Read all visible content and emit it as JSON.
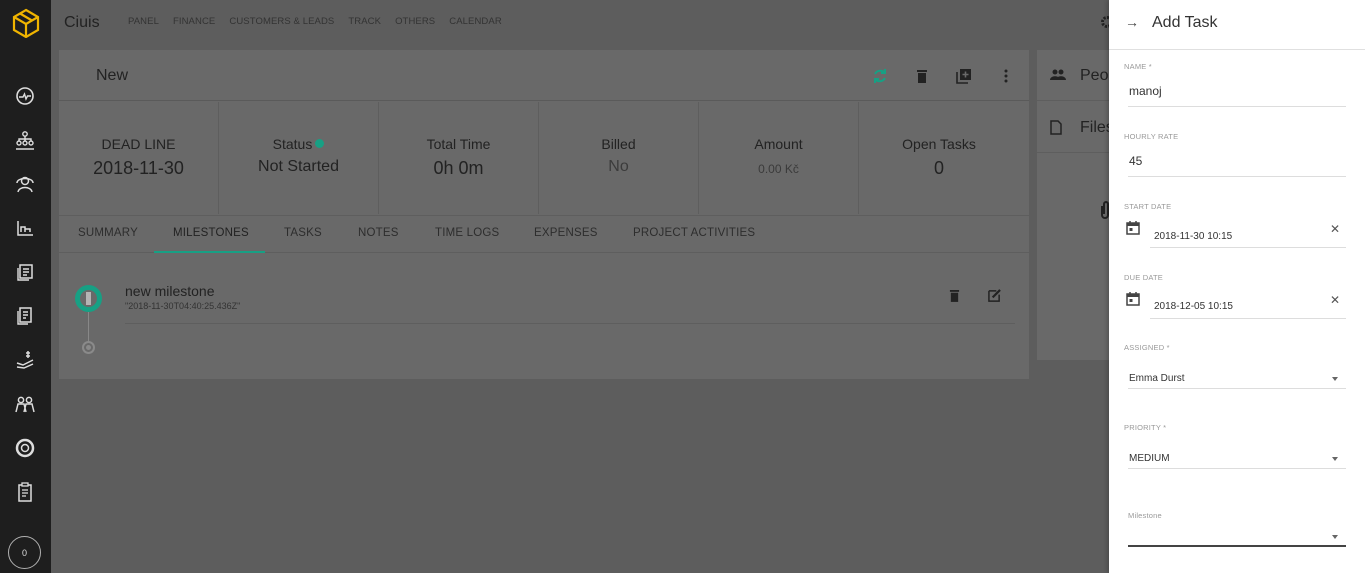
{
  "app": {
    "title": "Ciuis"
  },
  "topnav": [
    "PANEL",
    "FINANCE",
    "CUSTOMERS & LEADS",
    "TRACK",
    "OTHERS",
    "CALENDAR"
  ],
  "sidebar": {
    "counter": "0"
  },
  "project": {
    "title": "New",
    "stats": {
      "deadline_label": "DEAD LINE",
      "deadline": "2018-11-30",
      "status_label": "Status",
      "status": "Not Started",
      "total_time_label": "Total Time",
      "total_time": "0h 0m",
      "billed_label": "Billed",
      "billed": "No",
      "amount_label": "Amount",
      "amount": "0.00 Kč",
      "open_tasks_label": "Open Tasks",
      "open_tasks": "0"
    },
    "tabs": [
      "SUMMARY",
      "MILESTONES",
      "TASKS",
      "NOTES",
      "TIME LOGS",
      "EXPENSES",
      "PROJECT ACTIVITIES"
    ],
    "milestone": {
      "title": "new milestone",
      "date": "\"2018-11-30T04:40:25.436Z\""
    }
  },
  "right_card": {
    "people": "Peo",
    "files": "Files"
  },
  "panel": {
    "title": "Add Task",
    "name_label": "NAME *",
    "name_value": "manoj",
    "rate_label": "HOURLY RATE",
    "rate_value": "45",
    "start_label": "START DATE",
    "start_value": "2018-11-30 10:15",
    "due_label": "DUE DATE",
    "due_value": "2018-12-05 10:15",
    "assigned_label": "ASSIGNED *",
    "assigned_value": "Emma Durst",
    "priority_label": "PRIORITY *",
    "priority_value": "MEDIUM",
    "milestone_label": "Milestone"
  },
  "colors": {
    "accent": "#17a084",
    "logo": "#f0b400",
    "sidebar": "#1e1e1e"
  }
}
